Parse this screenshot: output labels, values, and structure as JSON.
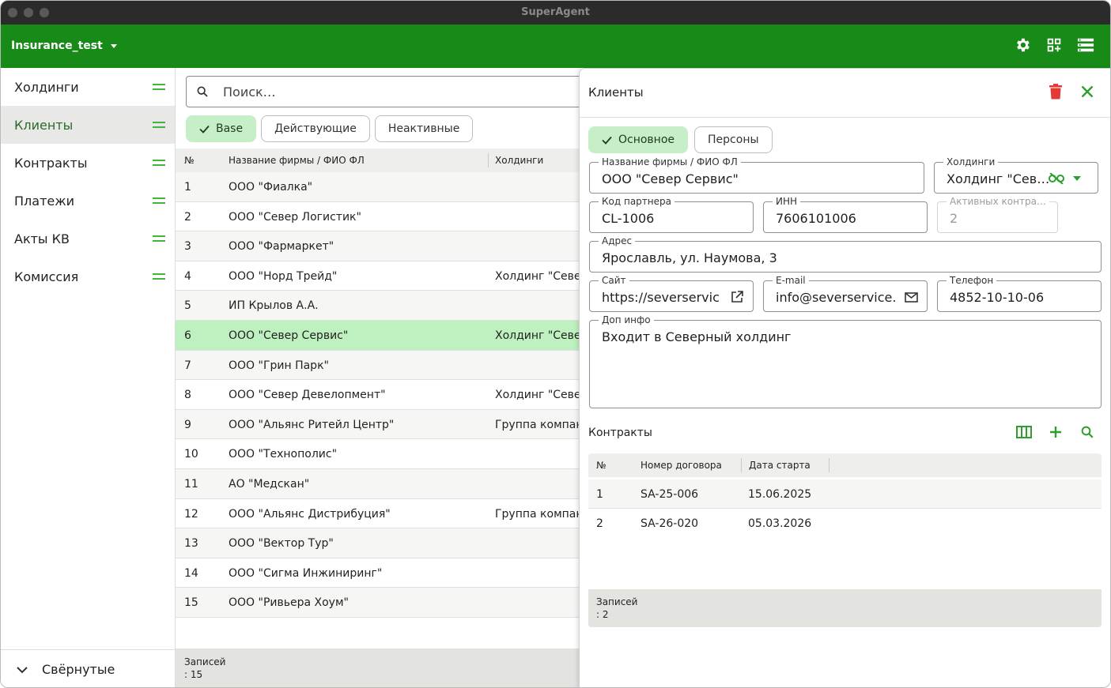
{
  "window": {
    "title": "SuperAgent"
  },
  "appbar": {
    "db_name": "Insurance_test",
    "icons": [
      "gear-icon",
      "qr-add-icon",
      "list-view-icon"
    ],
    "background": "#178a17"
  },
  "sidebar": {
    "items": [
      {
        "label": "Холдинги",
        "active": false
      },
      {
        "label": "Клиенты",
        "active": true
      },
      {
        "label": "Контракты",
        "active": false
      },
      {
        "label": "Платежи",
        "active": false
      },
      {
        "label": "Акты КВ",
        "active": false
      },
      {
        "label": "Комиссия",
        "active": false
      }
    ],
    "collapsed_label": "Свёрнутые"
  },
  "list": {
    "search_placeholder": "Поиск…",
    "filters": [
      {
        "label": "Base",
        "selected": true
      },
      {
        "label": "Действующие",
        "selected": false
      },
      {
        "label": "Неактивные",
        "selected": false
      }
    ],
    "columns": {
      "num": "№",
      "name": "Название фирмы / ФИО ФЛ",
      "holding": "Холдинги"
    },
    "rows": [
      {
        "num": "1",
        "name": "ООО \"Фиалка\"",
        "holding": ""
      },
      {
        "num": "2",
        "name": "ООО \"Север Логистик\"",
        "holding": ""
      },
      {
        "num": "3",
        "name": "ООО \"Фармаркет\"",
        "holding": ""
      },
      {
        "num": "4",
        "name": "ООО \"Норд Трейд\"",
        "holding": "Холдинг \"Севе"
      },
      {
        "num": "5",
        "name": "ИП Крылов А.А.",
        "holding": ""
      },
      {
        "num": "6",
        "name": "ООО \"Север Сервис\"",
        "holding": "Холдинг \"Севе"
      },
      {
        "num": "7",
        "name": "ООО \"Грин Парк\"",
        "holding": ""
      },
      {
        "num": "8",
        "name": "ООО \"Север Девелопмент\"",
        "holding": "Холдинг \"Севе"
      },
      {
        "num": "9",
        "name": "ООО \"Альянс Ритейл Центр\"",
        "holding": "Группа компан"
      },
      {
        "num": "10",
        "name": "ООО \"Технополис\"",
        "holding": ""
      },
      {
        "num": "11",
        "name": "АО \"Медскан\"",
        "holding": ""
      },
      {
        "num": "12",
        "name": "ООО \"Альянс Дистрибуция\"",
        "holding": "Группа компан"
      },
      {
        "num": "13",
        "name": "ООО \"Вектор Тур\"",
        "holding": ""
      },
      {
        "num": "14",
        "name": "ООО \"Сигма Инжиниринг\"",
        "holding": ""
      },
      {
        "num": "15",
        "name": "ООО \"Ривьера Хоум\"",
        "holding": ""
      }
    ],
    "selected_row": 6,
    "footer_line1": "Записей",
    "footer_line2": ": 15"
  },
  "panel": {
    "title": "Клиенты",
    "tabs": [
      {
        "label": "Основное",
        "selected": true
      },
      {
        "label": "Персоны",
        "selected": false
      }
    ],
    "fields": {
      "name": {
        "label": "Название фирмы / ФИО ФЛ",
        "value": "ООО \"Север Сервис\""
      },
      "holding": {
        "label": "Холдинги",
        "value": "Холдинг \"Север…"
      },
      "partner_code": {
        "label": "Код партнера",
        "value": "CL-1006"
      },
      "inn": {
        "label": "ИНН",
        "value": "7606101006"
      },
      "active_contracts": {
        "label": "Активных контра…",
        "value": "2"
      },
      "address": {
        "label": "Адрес",
        "value": "Ярославль, ул. Наумова, 3"
      },
      "site": {
        "label": "Сайт",
        "value": "https://severservic"
      },
      "email": {
        "label": "E-mail",
        "value": "info@severservice."
      },
      "phone": {
        "label": "Телефон",
        "value": "4852-10-10-06"
      },
      "info": {
        "label": "Доп инфо",
        "value": "Входит в Северный холдинг"
      }
    },
    "contracts": {
      "title": "Контракты",
      "columns": {
        "num": "№",
        "number": "Номер договора",
        "start": "Дата старта"
      },
      "rows": [
        {
          "num": "1",
          "number": "SA-25-006",
          "start": "15.06.2025"
        },
        {
          "num": "2",
          "number": "SA-26-020",
          "start": "05.03.2026"
        }
      ],
      "footer_line1": "Записей",
      "footer_line2": ": 2"
    },
    "colors": {
      "delete": "#e53935",
      "accent": "#2e9e2e"
    }
  }
}
